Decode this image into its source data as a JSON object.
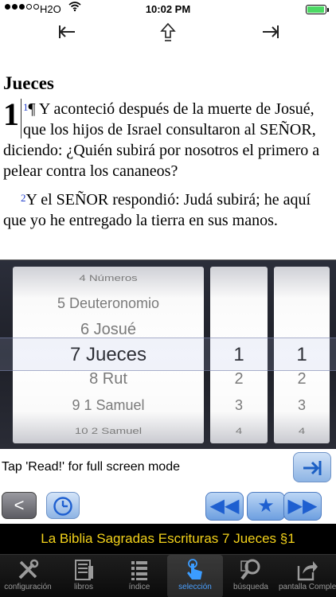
{
  "status_bar": {
    "carrier": "H2O",
    "time": "10:02 PM",
    "battery_level": 0.95,
    "signal_bars_filled": 3,
    "signal_bars_total": 5
  },
  "top_nav": {
    "prev_icon": "arrow-left-bar-icon",
    "up_icon": "arrow-up-outline-icon",
    "next_icon": "arrow-right-bar-icon"
  },
  "reader": {
    "book_title": "Jueces",
    "chapter_number": "1",
    "verses": [
      {
        "num": "1",
        "text": "¶ Y aconteció después de la muerte de Josué, que los hijos de Israel consultaron al SEÑOR, diciendo: ¿Quién subirá por nosotros el primero a pelear contra los cananeos?"
      },
      {
        "num": "2",
        "text": "Y el SEÑOR respondió: Judá subirá; he aquí que yo he entregado la tierra en sus manos."
      }
    ]
  },
  "picker": {
    "books": [
      "4 Números",
      "5 Deuteronomio",
      "6 Josué",
      "7 Jueces",
      "8 Rut",
      "9 1 Samuel",
      "10 2 Samuel"
    ],
    "chapters": [
      "1",
      "2",
      "3",
      "4"
    ],
    "verses": [
      "1",
      "2",
      "3",
      "4"
    ],
    "selected_book_index": 3,
    "selected_chapter_index": 0,
    "selected_verse_index": 0
  },
  "hint": {
    "text": "Tap 'Read!' for full screen mode",
    "read_icon": "arrow-right-bar-icon"
  },
  "controls": {
    "back_label": "<",
    "rewind_label": "◀◀",
    "star_label": "★",
    "forward_label": "▶▶"
  },
  "banner": {
    "text": "La Biblia Sagradas Escrituras 7 Jueces §1"
  },
  "tabs": [
    {
      "label": "configuración",
      "icon": "tools-icon"
    },
    {
      "label": "libros",
      "icon": "books-icon"
    },
    {
      "label": "índice",
      "icon": "list-icon"
    },
    {
      "label": "selección",
      "icon": "tap-hand-icon",
      "active": true
    },
    {
      "label": "búsqueda",
      "icon": "magnifier-icon"
    },
    {
      "label": "pantalla Completa",
      "icon": "share-icon"
    }
  ],
  "colors": {
    "verse_number": "#2340cc",
    "banner_text": "#f3d21a",
    "tab_active": "#4aa0ff",
    "button_blue": "#1e5fd0"
  }
}
